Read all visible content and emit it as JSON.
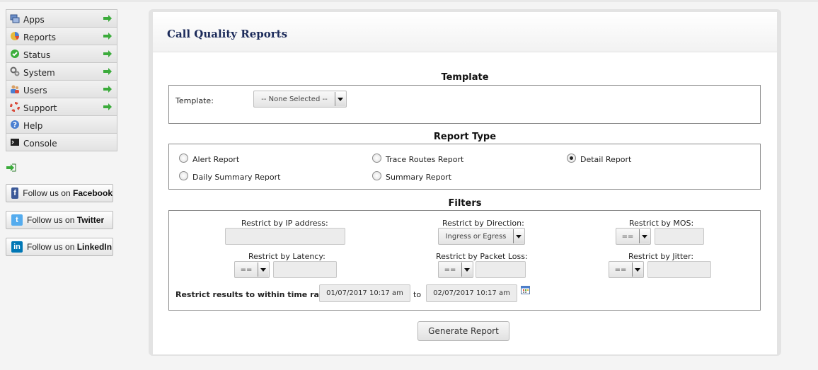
{
  "sidebar": {
    "items": [
      {
        "label": "Apps",
        "icon": "apps-icon"
      },
      {
        "label": "Reports",
        "icon": "reports-icon"
      },
      {
        "label": "Status",
        "icon": "status-icon"
      },
      {
        "label": "System",
        "icon": "system-icon"
      },
      {
        "label": "Users",
        "icon": "users-icon"
      },
      {
        "label": "Support",
        "icon": "support-icon"
      },
      {
        "label": "Help",
        "icon": "help-icon"
      },
      {
        "label": "Console",
        "icon": "console-icon"
      }
    ]
  },
  "social": {
    "facebook": {
      "prefix": "Follow us on ",
      "brand": "Facebook"
    },
    "twitter": {
      "prefix": "Follow us on ",
      "brand": "Twitter"
    },
    "linkedin": {
      "prefix": "Follow us on ",
      "brand": "LinkedIn"
    }
  },
  "page": {
    "title": "Call Quality Reports"
  },
  "template_section": {
    "title": "Template",
    "label": "Template:",
    "selected": "-- None Selected --"
  },
  "report_type": {
    "title": "Report Type",
    "options": [
      {
        "label": "Alert Report",
        "checked": false
      },
      {
        "label": "Trace Routes Report",
        "checked": false
      },
      {
        "label": "Detail Report",
        "checked": true
      },
      {
        "label": "Daily Summary Report",
        "checked": false
      },
      {
        "label": "Summary Report",
        "checked": false
      }
    ]
  },
  "filters": {
    "title": "Filters",
    "ip_label": "Restrict by IP address:",
    "direction_label": "Restrict by Direction:",
    "direction_value": "Ingress or Egress",
    "mos_label": "Restrict by MOS:",
    "mos_op": "==",
    "latency_label": "Restrict by Latency:",
    "latency_op": "==",
    "packet_loss_label": "Restrict by Packet Loss:",
    "packet_loss_op": "==",
    "jitter_label": "Restrict by Jitter:",
    "jitter_op": "==",
    "time_range_label": "Restrict results to within time range:",
    "time_from": "01/07/2017 10:17 am",
    "to_label": "to",
    "time_to": "02/07/2017 10:17 am"
  },
  "actions": {
    "generate_label": "Generate Report"
  },
  "colors": {
    "title": "#1c2b5a",
    "facebook": "#3b5998",
    "twitter": "#55acee",
    "linkedin": "#0077b5",
    "nav_arrow": "#3bab3b"
  }
}
